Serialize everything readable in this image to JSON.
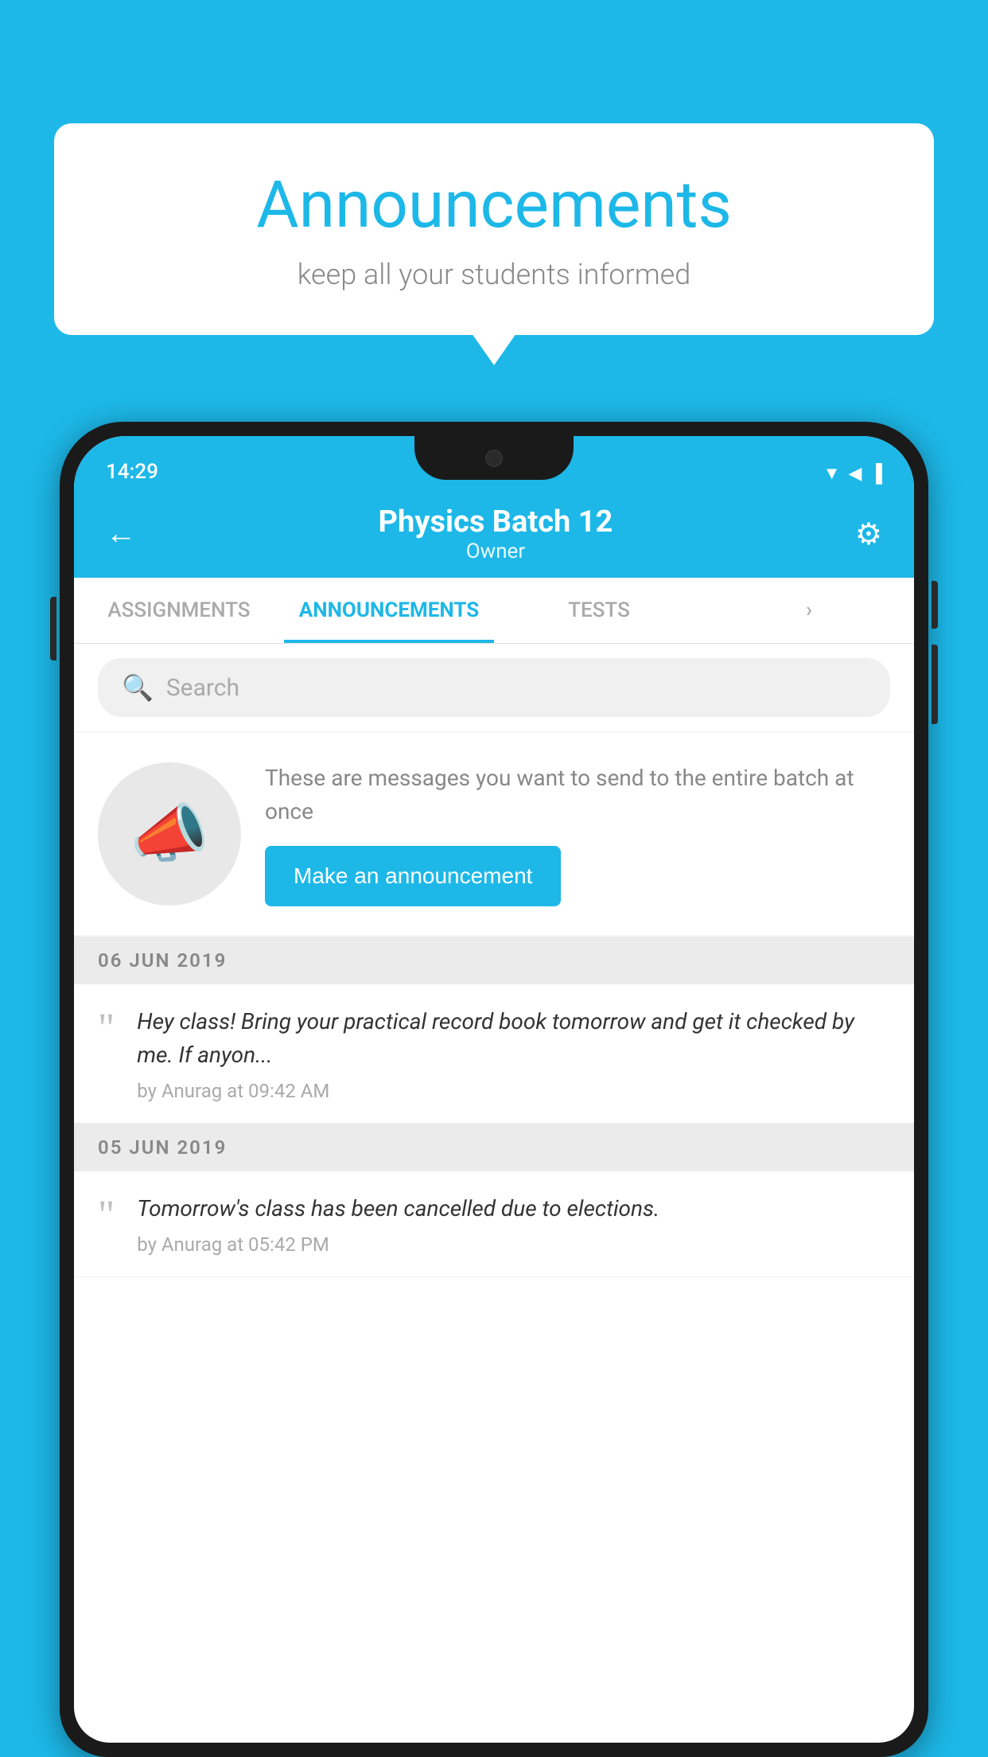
{
  "background_color": "#1db8e8",
  "speech_bubble": {
    "title": "Announcements",
    "subtitle": "keep all your students informed"
  },
  "phone": {
    "status_bar": {
      "time": "14:29",
      "wifi": "▲",
      "signal": "▲",
      "battery": "▌"
    },
    "header": {
      "back_label": "←",
      "title": "Physics Batch 12",
      "subtitle": "Owner",
      "settings_label": "⚙"
    },
    "tabs": [
      {
        "label": "ASSIGNMENTS",
        "active": false
      },
      {
        "label": "ANNOUNCEMENTS",
        "active": true
      },
      {
        "label": "TESTS",
        "active": false
      },
      {
        "label": "›",
        "active": false
      }
    ],
    "search": {
      "placeholder": "Search"
    },
    "promo": {
      "description": "These are messages you want to send to the entire batch at once",
      "button_label": "Make an announcement"
    },
    "announcements": [
      {
        "date": "06  JUN  2019",
        "text": "Hey class! Bring your practical record book tomorrow and get it checked by me. If anyon...",
        "meta": "by Anurag at 09:42 AM"
      },
      {
        "date": "05  JUN  2019",
        "text": "Tomorrow's class has been cancelled due to elections.",
        "meta": "by Anurag at 05:42 PM"
      }
    ]
  }
}
